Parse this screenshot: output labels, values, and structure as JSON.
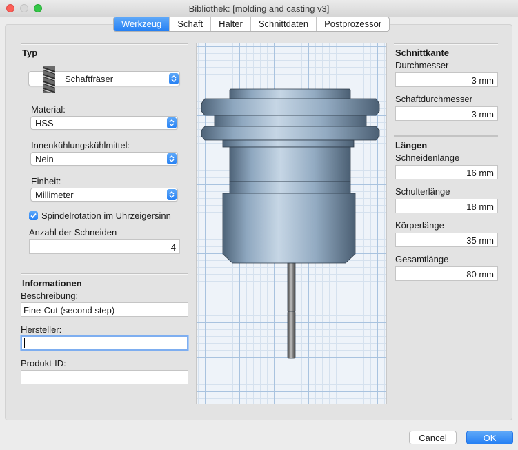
{
  "window": {
    "title": "Bibliothek: [molding and casting v3]"
  },
  "tabs": [
    "Werkzeug",
    "Schaft",
    "Halter",
    "Schnittdaten",
    "Postprozessor"
  ],
  "typ": {
    "heading": "Typ",
    "tool_type": "Schaftfräser",
    "material_label": "Material:",
    "material": "HSS",
    "coolant_label": "Innenkühlungskühlmittel:",
    "coolant": "Nein",
    "unit_label": "Einheit:",
    "unit": "Millimeter",
    "spindle_label": "Spindelrotation im Uhrzeigersinn",
    "spindle_checked": true,
    "flutes_label": "Anzahl der Schneiden",
    "flutes": "4"
  },
  "info": {
    "heading": "Informationen",
    "description_label": "Beschreibung:",
    "description": "Fine-Cut (second step)",
    "manufacturer_label": "Hersteller:",
    "manufacturer": "",
    "product_id_label": "Produkt-ID:",
    "product_id": ""
  },
  "cutting_edge": {
    "heading": "Schnittkante",
    "diameter_label": "Durchmesser",
    "diameter": "3 mm",
    "shaft_diameter_label": "Schaftdurchmesser",
    "shaft_diameter": "3 mm"
  },
  "lengths": {
    "heading": "Längen",
    "flute_length_label": "Schneidenlänge",
    "flute_length": "16 mm",
    "shoulder_length_label": "Schulterlänge",
    "shoulder_length": "18 mm",
    "body_length_label": "Körperlänge",
    "body_length": "35 mm",
    "overall_length_label": "Gesamtlänge",
    "overall_length": "80 mm"
  },
  "buttons": {
    "cancel": "Cancel",
    "ok": "OK"
  },
  "colors": {
    "accent": "#2580f4",
    "holder": "#8fa6bc",
    "grid_major": "#a9c3df",
    "grid_minor": "#d5e1ee"
  }
}
